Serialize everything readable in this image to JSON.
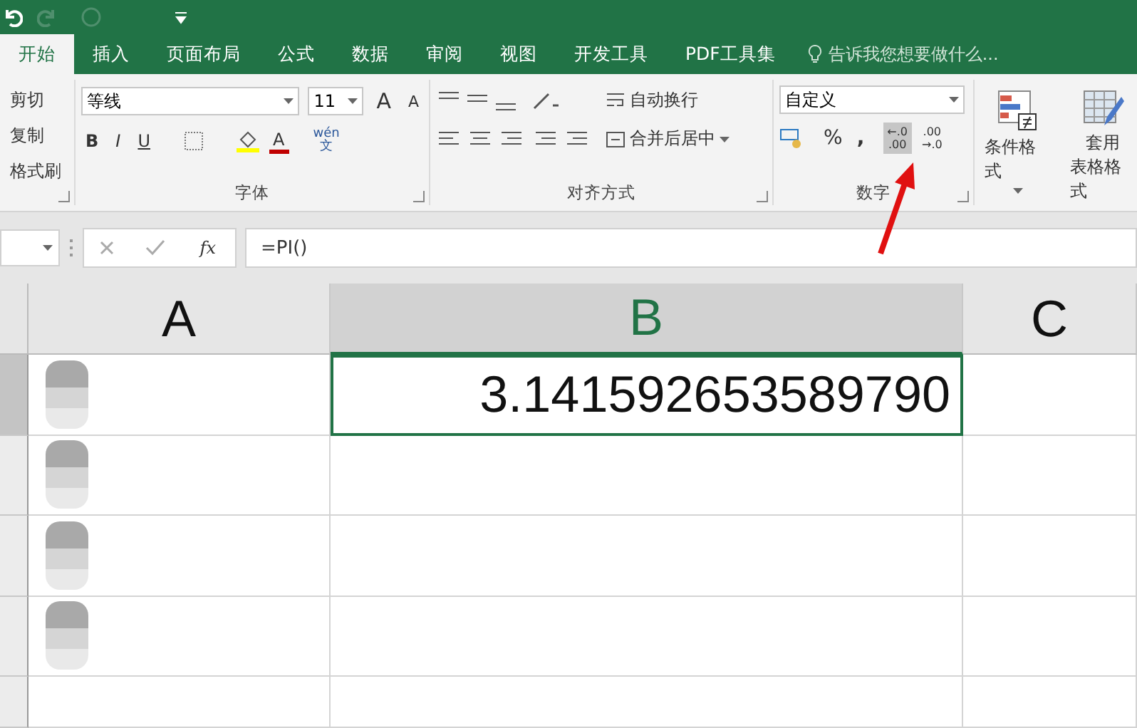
{
  "quick_access": {
    "undo_enabled": true,
    "redo_enabled": false
  },
  "tabs": [
    {
      "label": "开始",
      "selected": true
    },
    {
      "label": "插入",
      "selected": false
    },
    {
      "label": "页面布局",
      "selected": false
    },
    {
      "label": "公式",
      "selected": false
    },
    {
      "label": "数据",
      "selected": false
    },
    {
      "label": "审阅",
      "selected": false
    },
    {
      "label": "视图",
      "selected": false
    },
    {
      "label": "开发工具",
      "selected": false
    },
    {
      "label": "PDF工具集",
      "selected": false
    }
  ],
  "tell_me": {
    "placeholder": "告诉我您想要做什么..."
  },
  "clipboard": {
    "items": [
      "剪切",
      "复制",
      "格式刷"
    ]
  },
  "font": {
    "name": "等线",
    "size": "11",
    "grow": "A",
    "shrink": "A",
    "bold": "B",
    "italic": "I",
    "underline": "U",
    "font_color": "A",
    "phonetic_top": "wén",
    "phonetic_bottom": "文",
    "label": "字体"
  },
  "alignment": {
    "wrap": "自动换行",
    "merge": "合并后居中",
    "label": "对齐方式"
  },
  "number": {
    "format": "自定义",
    "percent": "%",
    "comma": ",",
    "buttons": [
      {
        "top": "←.0",
        "bottom": ".00",
        "selected": true
      },
      {
        "top": ".00",
        "bottom": "→.0",
        "selected": false
      }
    ],
    "label": "数字"
  },
  "styles": {
    "conditional": "条件格式",
    "table_top": "套用",
    "table_bottom": "表格格式"
  },
  "formula_bar": {
    "fx": "fx",
    "value": "=PI()"
  },
  "sheet": {
    "columns": [
      {
        "label": "A",
        "selected": false
      },
      {
        "label": "B",
        "selected": true
      },
      {
        "label": "C",
        "selected": false
      }
    ],
    "rows": [
      {
        "b": "3.141592653589790",
        "selected": true
      },
      {
        "b": "",
        "selected": false
      },
      {
        "b": "",
        "selected": false
      },
      {
        "b": "",
        "selected": false
      },
      {
        "b": "",
        "selected": false
      }
    ]
  }
}
